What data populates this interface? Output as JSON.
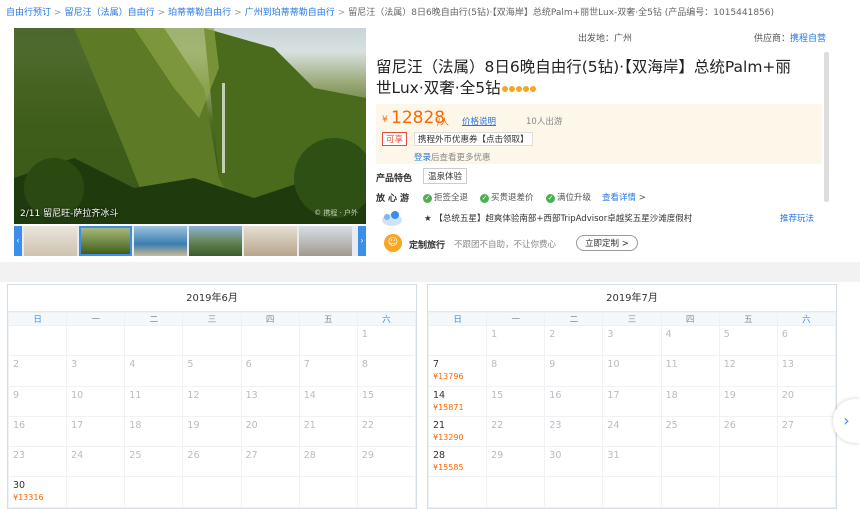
{
  "breadcrumb": {
    "items": [
      "自由行预订",
      "留尼汪（法属）自由行",
      "珀蒂蒂勒自由行",
      "广州到珀蒂蒂勒自由行"
    ],
    "current": "留尼汪（法属）8日6晚自由行(5钻)·【双海岸】总统Palm+丽世Lux-双奢·全5钻 (产品编号：1015441856)",
    "separator": ">"
  },
  "gallery": {
    "caption": "2/11 留尼旺-萨拉齐冰斗",
    "watermark": "© 携程 · 户外",
    "prev_icon": "chevron-left-icon",
    "next_icon": "chevron-right-icon",
    "thumbnails": [
      "thumb-1",
      "thumb-2",
      "thumb-3",
      "thumb-4",
      "thumb-5",
      "thumb-6"
    ]
  },
  "info": {
    "origin": "出发地：广州",
    "vendor_label": "供应商：",
    "vendor_name": "携程自营",
    "title": "留尼汪（法属）8日6晚自由行(5钻)·【双海岸】总统Palm+丽世Lux·双奢·全5钻",
    "gems": 5
  },
  "price": {
    "currency": "¥",
    "amount": "12828",
    "unit": "/人",
    "note": "价格说明",
    "booked": "10人出游",
    "tag": "可享",
    "coupon": "携程外币优惠券【点击领取】",
    "login_link": "登录",
    "login_text": "后查看更多优惠"
  },
  "features": {
    "label": "产品特色",
    "tag": "温泉体验"
  },
  "worry_free": {
    "label": "放心游",
    "items": [
      "拒签全退",
      "买贵退差价",
      "满位升级"
    ],
    "more": "查看详情",
    "more_arrow": ">"
  },
  "recommend": {
    "star": "★",
    "text": "【总统五星】超爽体验南部+西部TripAdvisor卓越奖五星沙滩度假村",
    "link": "推荐玩法"
  },
  "custom": {
    "icon": "person-icon",
    "title": "定制旅行",
    "desc": "不跟团不自助，不让你费心",
    "button": "立即定制",
    "button_arrow": ">"
  },
  "calendar": {
    "weekdays": [
      "日",
      "一",
      "二",
      "三",
      "四",
      "五",
      "六"
    ],
    "next_icon": "›",
    "months": [
      {
        "title": "2019年6月",
        "rows": [
          [
            {
              "d": ""
            },
            {
              "d": ""
            },
            {
              "d": ""
            },
            {
              "d": ""
            },
            {
              "d": ""
            },
            {
              "d": ""
            },
            {
              "d": "1"
            }
          ],
          [
            {
              "d": "2"
            },
            {
              "d": "3"
            },
            {
              "d": "4"
            },
            {
              "d": "5"
            },
            {
              "d": "6"
            },
            {
              "d": "7"
            },
            {
              "d": "8"
            }
          ],
          [
            {
              "d": "9"
            },
            {
              "d": "10"
            },
            {
              "d": "11"
            },
            {
              "d": "12"
            },
            {
              "d": "13"
            },
            {
              "d": "14"
            },
            {
              "d": "15"
            }
          ],
          [
            {
              "d": "16"
            },
            {
              "d": "17"
            },
            {
              "d": "18"
            },
            {
              "d": "19"
            },
            {
              "d": "20"
            },
            {
              "d": "21"
            },
            {
              "d": "22"
            }
          ],
          [
            {
              "d": "23"
            },
            {
              "d": "24"
            },
            {
              "d": "25"
            },
            {
              "d": "26"
            },
            {
              "d": "27"
            },
            {
              "d": "28"
            },
            {
              "d": "29"
            }
          ],
          [
            {
              "d": "30",
              "p": "¥13316"
            },
            {
              "d": ""
            },
            {
              "d": ""
            },
            {
              "d": ""
            },
            {
              "d": ""
            },
            {
              "d": ""
            },
            {
              "d": ""
            }
          ]
        ]
      },
      {
        "title": "2019年7月",
        "rows": [
          [
            {
              "d": ""
            },
            {
              "d": "1"
            },
            {
              "d": "2"
            },
            {
              "d": "3"
            },
            {
              "d": "4"
            },
            {
              "d": "5"
            },
            {
              "d": "6"
            }
          ],
          [
            {
              "d": "7",
              "p": "¥13796"
            },
            {
              "d": "8"
            },
            {
              "d": "9"
            },
            {
              "d": "10"
            },
            {
              "d": "11"
            },
            {
              "d": "12"
            },
            {
              "d": "13"
            }
          ],
          [
            {
              "d": "14",
              "p": "¥15871"
            },
            {
              "d": "15"
            },
            {
              "d": "16"
            },
            {
              "d": "17"
            },
            {
              "d": "18"
            },
            {
              "d": "19"
            },
            {
              "d": "20"
            }
          ],
          [
            {
              "d": "21",
              "p": "¥13290"
            },
            {
              "d": "22"
            },
            {
              "d": "23"
            },
            {
              "d": "24"
            },
            {
              "d": "25"
            },
            {
              "d": "26"
            },
            {
              "d": "27"
            }
          ],
          [
            {
              "d": "28",
              "p": "¥15585"
            },
            {
              "d": "29"
            },
            {
              "d": "30"
            },
            {
              "d": "31"
            },
            {
              "d": ""
            },
            {
              "d": ""
            },
            {
              "d": ""
            }
          ],
          [
            {
              "d": ""
            },
            {
              "d": ""
            },
            {
              "d": ""
            },
            {
              "d": ""
            },
            {
              "d": ""
            },
            {
              "d": ""
            },
            {
              "d": ""
            }
          ]
        ]
      }
    ]
  }
}
